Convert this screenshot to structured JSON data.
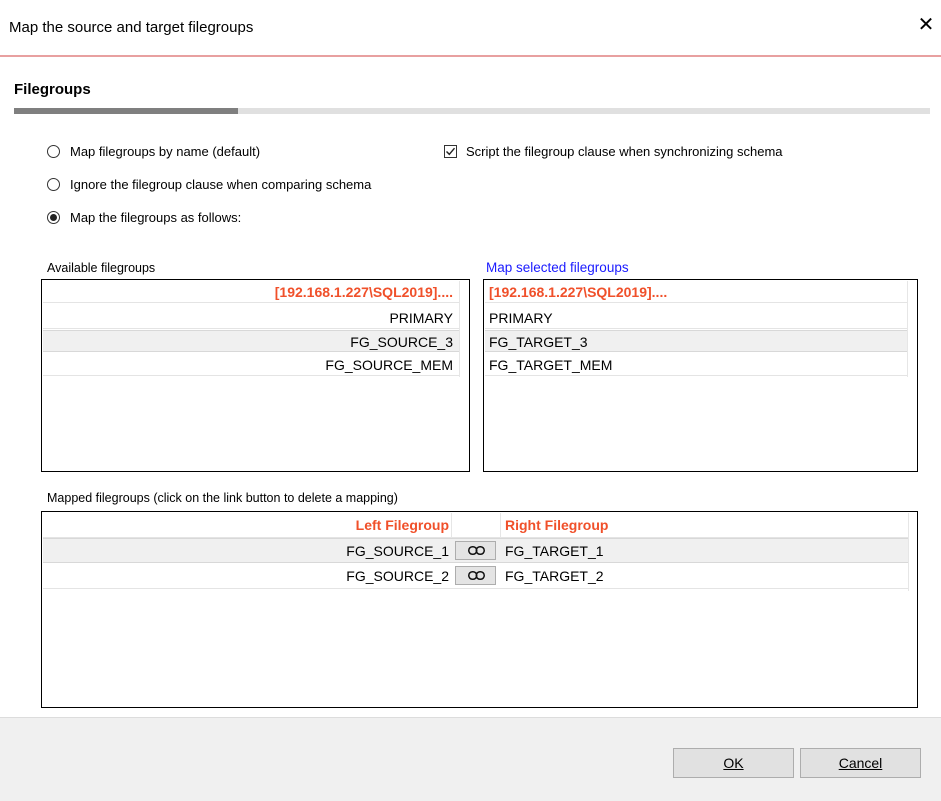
{
  "dialog": {
    "title": "Map the source and target filegroups",
    "close_glyph": "✕"
  },
  "section": {
    "title": "Filegroups"
  },
  "options": {
    "by_name": "Map filegroups by name (default)",
    "ignore": "Ignore the filegroup clause when comparing schema",
    "as_follows": "Map the filegroups as follows:",
    "script_clause": "Script the filegroup clause when synchronizing schema",
    "selected_option": "as_follows",
    "script_clause_checked": true
  },
  "available": {
    "label": "Available filegroups",
    "header": "[192.168.1.227\\SQL2019]....",
    "items": [
      "PRIMARY",
      "FG_SOURCE_3",
      "FG_SOURCE_MEM"
    ]
  },
  "map_selected": {
    "label": "Map selected filegroups",
    "label_color": "#1a1aff",
    "header": "[192.168.1.227\\SQL2019]....",
    "items": [
      "PRIMARY",
      "FG_TARGET_3",
      "FG_TARGET_MEM"
    ]
  },
  "mapped": {
    "label": "Mapped filegroups (click on the link button to delete a mapping)",
    "left_header": "Left Filegroup",
    "right_header": "Right Filegroup",
    "rows": [
      {
        "left": "FG_SOURCE_1",
        "right": "FG_TARGET_1"
      },
      {
        "left": "FG_SOURCE_2",
        "right": "FG_TARGET_2"
      }
    ]
  },
  "buttons": {
    "ok": "OK",
    "cancel": "Cancel"
  },
  "colors": {
    "header_accent": "#f0502a",
    "title_border": "#e8a0a0"
  }
}
